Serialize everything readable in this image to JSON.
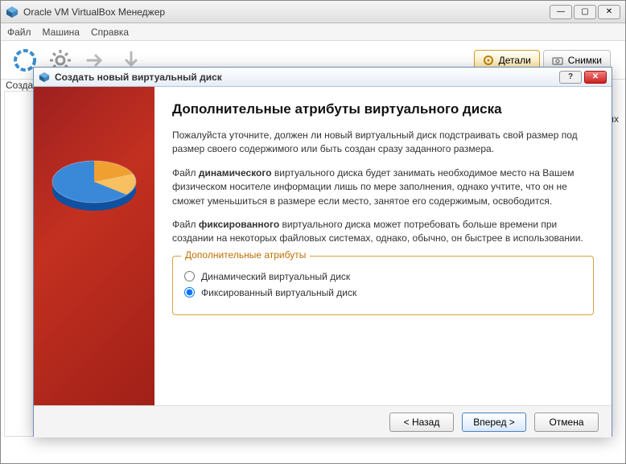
{
  "main_window": {
    "title": "Oracle VM VirtualBox Менеджер",
    "menu": {
      "file": "Файл",
      "machine": "Машина",
      "help": "Справка"
    },
    "toolbar": {
      "create_label": "Созда"
    },
    "tabs": {
      "details": "Детали",
      "snapshots": "Снимки"
    },
    "right_text": "ых"
  },
  "dialog": {
    "title": "Создать новый виртуальный диск",
    "heading": "Дополнительные атрибуты виртуального диска",
    "p1": "Пожалуйста уточните, должен ли новый виртуальный диск подстраивать свой размер под размер своего содержимого или быть создан сразу заданного размера.",
    "p2_before": "Файл ",
    "p2_bold": "динамического",
    "p2_after": " виртуального диска будет занимать необходимое место на Вашем физическом носителе информации лишь по мере заполнения, однако учтите, что он не сможет уменьшиться в размере если место, занятое его содержимым, освободится.",
    "p3_before": "Файл ",
    "p3_bold": "фиксированного",
    "p3_after": " виртуального диска может потребовать больше времени при создании на некоторых файловых системах, однако, обычно, он быстрее в использовании.",
    "group_legend": "Дополнительные атрибуты",
    "option_dynamic": "Динамический виртуальный диск",
    "option_fixed": "Фиксированный виртуальный диск",
    "buttons": {
      "back": "< Назад",
      "next": "Вперед >",
      "cancel": "Отмена"
    }
  }
}
